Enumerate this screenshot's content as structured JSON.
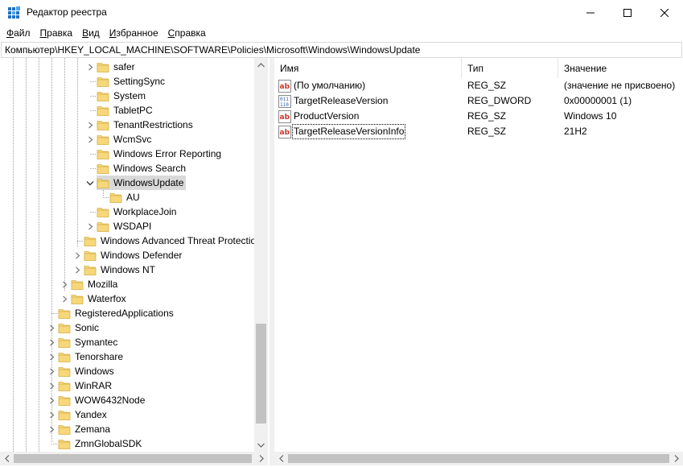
{
  "window": {
    "title": "Редактор реестра",
    "icon": "registry-editor-icon"
  },
  "menu": [
    {
      "label": "Файл"
    },
    {
      "label": "Правка"
    },
    {
      "label": "Вид"
    },
    {
      "label": "Избранное"
    },
    {
      "label": "Справка"
    }
  ],
  "address": "Компьютер\\HKEY_LOCAL_MACHINE\\SOFTWARE\\Policies\\Microsoft\\Windows\\WindowsUpdate",
  "tree": [
    {
      "label": "safer",
      "expander": "collapsed",
      "selected": false
    },
    {
      "label": "SettingSync",
      "expander": "none",
      "selected": false
    },
    {
      "label": "System",
      "expander": "none",
      "selected": false
    },
    {
      "label": "TabletPC",
      "expander": "none",
      "selected": false
    },
    {
      "label": "TenantRestrictions",
      "expander": "collapsed",
      "selected": false
    },
    {
      "label": "WcmSvc",
      "expander": "collapsed",
      "selected": false
    },
    {
      "label": "Windows Error Reporting",
      "expander": "none",
      "selected": false
    },
    {
      "label": "Windows Search",
      "expander": "none",
      "selected": false
    },
    {
      "label": "WindowsUpdate",
      "expander": "expanded",
      "selected": true
    },
    {
      "label": "AU",
      "expander": "none",
      "selected": false
    },
    {
      "label": "WorkplaceJoin",
      "expander": "none",
      "selected": false
    },
    {
      "label": "WSDAPI",
      "expander": "collapsed",
      "selected": false
    },
    {
      "label": "Windows Advanced Threat Protection",
      "expander": "none",
      "selected": false
    },
    {
      "label": "Windows Defender",
      "expander": "collapsed",
      "selected": false
    },
    {
      "label": "Windows NT",
      "expander": "collapsed",
      "selected": false
    },
    {
      "label": "Mozilla",
      "expander": "collapsed",
      "selected": false
    },
    {
      "label": "Waterfox",
      "expander": "collapsed",
      "selected": false
    },
    {
      "label": "RegisteredApplications",
      "expander": "none",
      "selected": false
    },
    {
      "label": "Sonic",
      "expander": "collapsed",
      "selected": false
    },
    {
      "label": "Symantec",
      "expander": "collapsed",
      "selected": false
    },
    {
      "label": "Tenorshare",
      "expander": "collapsed",
      "selected": false
    },
    {
      "label": "Windows",
      "expander": "collapsed",
      "selected": false
    },
    {
      "label": "WinRAR",
      "expander": "collapsed",
      "selected": false
    },
    {
      "label": "WOW6432Node",
      "expander": "collapsed",
      "selected": false
    },
    {
      "label": "Yandex",
      "expander": "collapsed",
      "selected": false
    },
    {
      "label": "Zemana",
      "expander": "collapsed",
      "selected": false
    },
    {
      "label": "ZmnGlobalSDK",
      "expander": "none",
      "selected": false
    }
  ],
  "values": {
    "columns": [
      "Имя",
      "Тип",
      "Значение"
    ],
    "rows": [
      {
        "name": "(По умолчанию)",
        "type": "REG_SZ",
        "data": "(значение не присвоено)",
        "icon": "string-value-icon"
      },
      {
        "name": "TargetReleaseVersion",
        "type": "REG_DWORD",
        "data": "0x00000001 (1)",
        "icon": "binary-value-icon"
      },
      {
        "name": "ProductVersion",
        "type": "REG_SZ",
        "data": "Windows 10",
        "icon": "string-value-icon"
      },
      {
        "name": "TargetReleaseVersionInfo",
        "type": "REG_SZ",
        "data": "21H2",
        "icon": "string-value-icon"
      }
    ]
  },
  "colors": {
    "folder": "#f6d77a",
    "selection": "#d9d9d9",
    "string_icon": "#c8372d",
    "dword_icon": "#2b5fb4"
  }
}
